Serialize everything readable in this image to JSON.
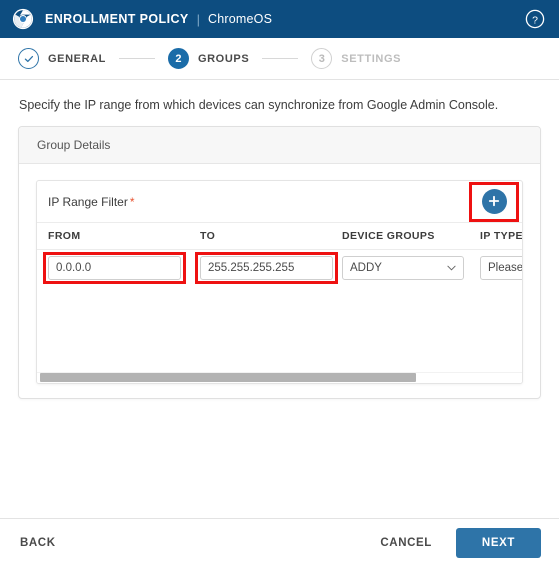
{
  "header": {
    "logo_icon": "chrome-logo-icon",
    "title": "ENROLLMENT POLICY",
    "separator": "|",
    "subtitle": "ChromeOS",
    "help_icon": "help-circle-icon",
    "bg_color": "#0d4d80"
  },
  "stepper": {
    "steps": [
      {
        "marker": "✓",
        "label": "GENERAL",
        "state": "done"
      },
      {
        "marker": "2",
        "label": "GROUPS",
        "state": "active"
      },
      {
        "marker": "3",
        "label": "SETTINGS",
        "state": "todo"
      }
    ],
    "active_color": "#1b6ca8",
    "done_color": "#2e74a8",
    "todo_color": "#bdbdbd"
  },
  "main": {
    "instruction": "Specify the IP range from which devices can synchronize from Google Admin Console.",
    "panel_title": "Group Details",
    "filter": {
      "label": "IP Range Filter",
      "required_marker": "*",
      "add_button_icon": "plus-icon",
      "add_button_color": "#2e74a8"
    },
    "table": {
      "columns": [
        "FROM",
        "TO",
        "DEVICE GROUPS",
        "IP TYPE"
      ],
      "rows": [
        {
          "from": "0.0.0.0",
          "to": "255.255.255.255",
          "device_groups": "ADDY",
          "ip_type": "Please S"
        }
      ]
    },
    "scrollbar": {
      "orientation": "horizontal",
      "thumb_fraction": "78%",
      "thumb_color": "#b3b3b3"
    },
    "annotations": {
      "color": "#ee1111",
      "targets": [
        "add-button",
        "from-input",
        "to-input"
      ]
    }
  },
  "footer": {
    "back_label": "BACK",
    "cancel_label": "CANCEL",
    "next_label": "NEXT",
    "next_color": "#2e74a8"
  }
}
